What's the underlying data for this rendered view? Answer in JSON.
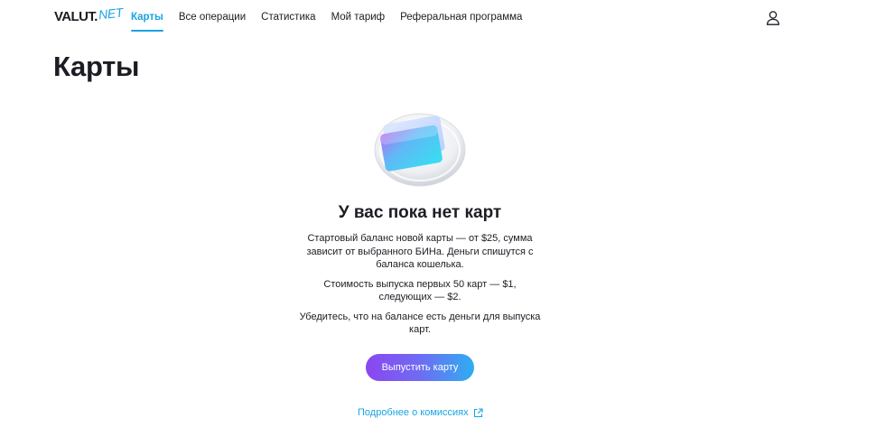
{
  "brand": {
    "logo_main": "VALUT.",
    "logo_accent": "NET"
  },
  "nav": {
    "items": [
      {
        "label": "Карты",
        "active": true
      },
      {
        "label": "Все операции",
        "active": false
      },
      {
        "label": "Статистика",
        "active": false
      },
      {
        "label": "Мой тариф",
        "active": false
      },
      {
        "label": "Реферальная программа",
        "active": false
      }
    ]
  },
  "header": {
    "user_icon": "user-icon"
  },
  "page": {
    "title": "Карты"
  },
  "empty_state": {
    "illustration_icon": "card-illustration-icon",
    "title": "У вас пока нет карт",
    "paragraphs": [
      "Стартовый баланс новой карты — от $25, сумма зависит от выбранного БИНа. Деньги спишутся с баланса кошелька.",
      "Стоимость выпуска первых 50 карт — $1, следующих — $2.",
      "Убедитесь, что на балансе есть деньги для выпуска карт."
    ],
    "issue_button": "Выпустить карту",
    "fee_link": "Подробнее о комиссиях",
    "fee_link_icon": "external-link-icon"
  },
  "colors": {
    "accent": "#1aa3e0",
    "text": "#1b1d23",
    "button_gradient_start": "#8b46f0",
    "button_gradient_end": "#2eaef2"
  }
}
